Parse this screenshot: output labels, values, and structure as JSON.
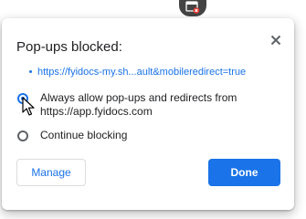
{
  "toolbar": {
    "icon": "popup-blocked-icon"
  },
  "dialog": {
    "title": "Pop-ups blocked:",
    "close_icon": "close-icon",
    "blocked_link": "https://fyidocs-my.sh...ault&mobileredirect=true",
    "options": [
      {
        "label": "Always allow pop-ups and redirects from https://app.fyidocs.com",
        "checked": true
      },
      {
        "label": "Continue blocking",
        "checked": false
      }
    ],
    "manage_label": "Manage",
    "done_label": "Done"
  },
  "colors": {
    "accent": "#1a73e8",
    "text": "#202124",
    "toolbar_bg": "#444444"
  }
}
